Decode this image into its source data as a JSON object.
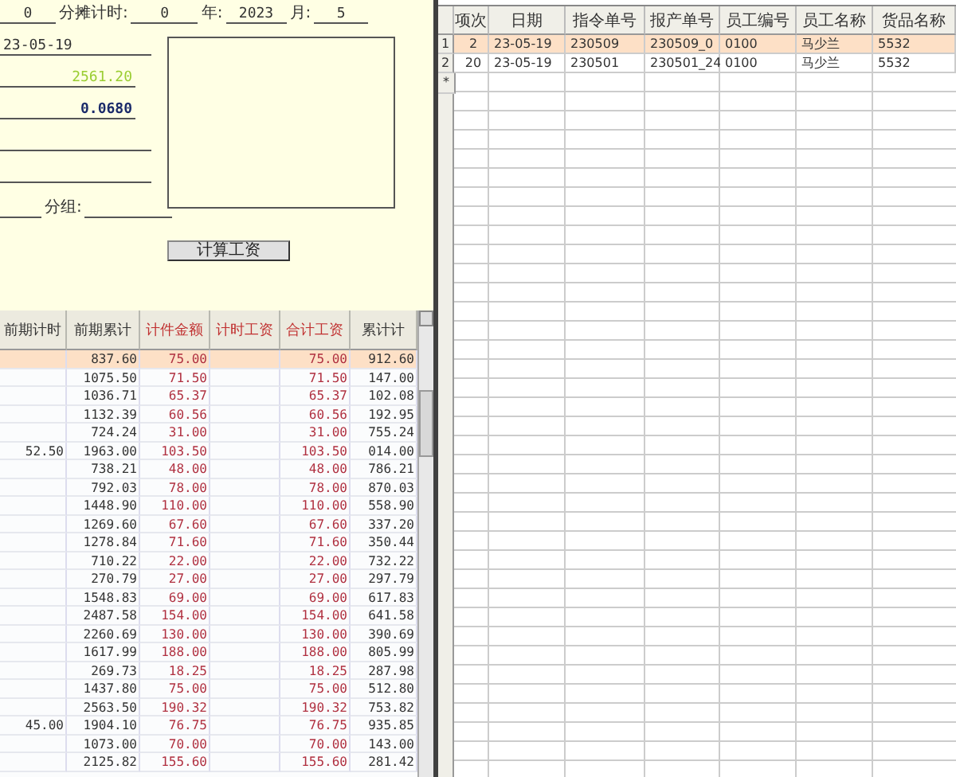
{
  "top_row": [
    {
      "kind": "field",
      "value": "0"
    },
    {
      "kind": "label",
      "text": "分摊计时:"
    },
    {
      "kind": "field",
      "value": "0"
    },
    {
      "kind": "label",
      "text": "年:"
    },
    {
      "kind": "field",
      "value": "2023"
    },
    {
      "kind": "label",
      "text": "月:"
    },
    {
      "kind": "field",
      "value": "5"
    }
  ],
  "date_field": "23-05-19",
  "amount_field": "2561.20",
  "rate_field": "0.0680",
  "group_label": "分组:",
  "calc_button": "计算工资",
  "wage_table": {
    "columns": [
      {
        "label": "前期计时",
        "accent": false
      },
      {
        "label": "前期累计",
        "accent": false
      },
      {
        "label": "计件金额",
        "accent": true
      },
      {
        "label": "计时工资",
        "accent": true
      },
      {
        "label": "合计工资",
        "accent": true
      },
      {
        "label": "累计计",
        "accent": false
      }
    ],
    "rows": [
      {
        "selected": true,
        "cells": [
          null,
          "837.60",
          "75.00",
          null,
          "75.00",
          "912.60"
        ]
      },
      {
        "selected": false,
        "cells": [
          null,
          "1075.50",
          "71.50",
          null,
          "71.50",
          "147.00"
        ]
      },
      {
        "selected": false,
        "cells": [
          null,
          "1036.71",
          "65.37",
          null,
          "65.37",
          "102.08"
        ]
      },
      {
        "selected": false,
        "cells": [
          null,
          "1132.39",
          "60.56",
          null,
          "60.56",
          "192.95"
        ]
      },
      {
        "selected": false,
        "cells": [
          null,
          "724.24",
          "31.00",
          null,
          "31.00",
          "755.24"
        ]
      },
      {
        "selected": false,
        "cells": [
          "52.50",
          "1963.00",
          "103.50",
          null,
          "103.50",
          "014.00"
        ]
      },
      {
        "selected": false,
        "cells": [
          null,
          "738.21",
          "48.00",
          null,
          "48.00",
          "786.21"
        ]
      },
      {
        "selected": false,
        "cells": [
          null,
          "792.03",
          "78.00",
          null,
          "78.00",
          "870.03"
        ]
      },
      {
        "selected": false,
        "cells": [
          null,
          "1448.90",
          "110.00",
          null,
          "110.00",
          "558.90"
        ]
      },
      {
        "selected": false,
        "cells": [
          null,
          "1269.60",
          "67.60",
          null,
          "67.60",
          "337.20"
        ]
      },
      {
        "selected": false,
        "cells": [
          null,
          "1278.84",
          "71.60",
          null,
          "71.60",
          "350.44"
        ]
      },
      {
        "selected": false,
        "cells": [
          null,
          "710.22",
          "22.00",
          null,
          "22.00",
          "732.22"
        ]
      },
      {
        "selected": false,
        "cells": [
          null,
          "270.79",
          "27.00",
          null,
          "27.00",
          "297.79"
        ]
      },
      {
        "selected": false,
        "cells": [
          null,
          "1548.83",
          "69.00",
          null,
          "69.00",
          "617.83"
        ]
      },
      {
        "selected": false,
        "cells": [
          null,
          "2487.58",
          "154.00",
          null,
          "154.00",
          "641.58"
        ]
      },
      {
        "selected": false,
        "cells": [
          null,
          "2260.69",
          "130.00",
          null,
          "130.00",
          "390.69"
        ]
      },
      {
        "selected": false,
        "cells": [
          null,
          "1617.99",
          "188.00",
          null,
          "188.00",
          "805.99"
        ]
      },
      {
        "selected": false,
        "cells": [
          null,
          "269.73",
          "18.25",
          null,
          "18.25",
          "287.98"
        ]
      },
      {
        "selected": false,
        "cells": [
          null,
          "1437.80",
          "75.00",
          null,
          "75.00",
          "512.80"
        ]
      },
      {
        "selected": false,
        "cells": [
          null,
          "2563.50",
          "190.32",
          null,
          "190.32",
          "753.82"
        ]
      },
      {
        "selected": false,
        "cells": [
          "45.00",
          "1904.10",
          "76.75",
          null,
          "76.75",
          "935.85"
        ]
      },
      {
        "selected": false,
        "cells": [
          null,
          "1073.00",
          "70.00",
          null,
          "70.00",
          "143.00"
        ]
      },
      {
        "selected": false,
        "cells": [
          null,
          "2125.82",
          "155.60",
          null,
          "155.60",
          "281.42"
        ]
      }
    ]
  },
  "order_table": {
    "columns": [
      "项次",
      "日期",
      "指令单号",
      "报产单号",
      "员工编号",
      "员工名称",
      "货品名称"
    ],
    "rows": [
      {
        "marker": "1",
        "selected": true,
        "cells": [
          "2",
          "23-05-19",
          "230509",
          "230509_0",
          "0100",
          "马少兰",
          "5532"
        ]
      },
      {
        "marker": "2",
        "selected": false,
        "cells": [
          "20",
          "23-05-19",
          "230501",
          "230501_24",
          "0100",
          "马少兰",
          "5532"
        ]
      }
    ],
    "new_row_marker": "*"
  }
}
